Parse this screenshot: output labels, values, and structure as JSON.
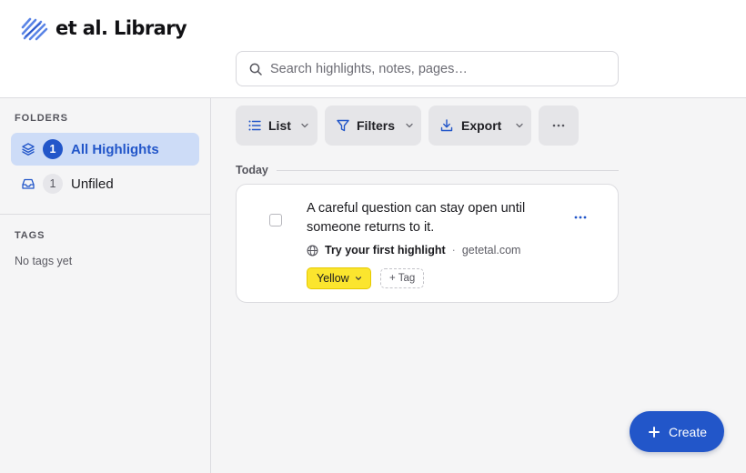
{
  "app": {
    "brand_name": "et al. Library",
    "logo_icon": "scribble-logo-icon"
  },
  "search": {
    "placeholder": "Search highlights, notes, pages…",
    "value": ""
  },
  "sidebar": {
    "folders_title": "FOLDERS",
    "folders": [
      {
        "label": "All Highlights",
        "count": "1",
        "icon": "layers-icon",
        "active": true
      },
      {
        "label": "Unfiled",
        "count": "1",
        "icon": "inbox-icon",
        "active": false
      }
    ],
    "tags_title": "TAGS",
    "tags_empty": "No tags yet"
  },
  "toolbar": {
    "view_label": "List",
    "filters_label": "Filters",
    "export_label": "Export",
    "more_icon": "more-horizontal-icon"
  },
  "feed": {
    "day_label": "Today",
    "highlights": [
      {
        "text": "A careful question can stay open until someone returns to it.",
        "source_title": "Try your first highlight",
        "separator": "·",
        "source_domain": "getetal.com",
        "color_label": "Yellow",
        "tag_label": "+ Tag"
      }
    ]
  },
  "fab": {
    "label": "Create"
  },
  "colors": {
    "accent": "#2256c9",
    "active_bg": "#cddcf7",
    "highlight_yellow": "#fbe52e",
    "page_bg": "#f5f5f6"
  }
}
